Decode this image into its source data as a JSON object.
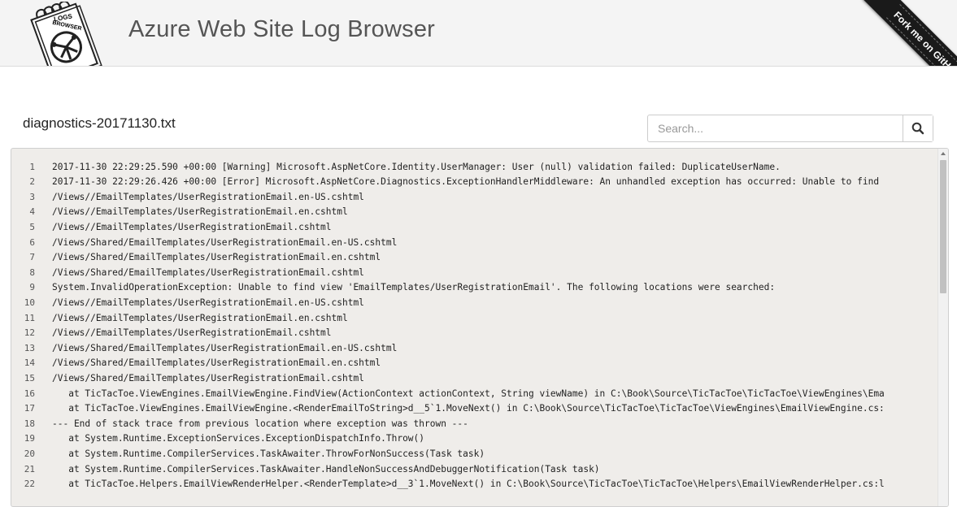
{
  "header": {
    "title": "Azure Web Site Log Browser",
    "logo_text_top": "LOGS",
    "logo_text_bottom": "BROWSER",
    "ribbon_label": "Fork me on GitHub"
  },
  "file": {
    "name": "diagnostics-20171130.txt"
  },
  "search": {
    "placeholder": "Search...",
    "icon": "search-icon"
  },
  "log": {
    "lines": [
      {
        "n": "1",
        "text": "2017-11-30 22:29:25.590 +00:00 [Warning] Microsoft.AspNetCore.Identity.UserManager: User (null) validation failed: DuplicateUserName."
      },
      {
        "n": "2",
        "text": "2017-11-30 22:29:26.426 +00:00 [Error] Microsoft.AspNetCore.Diagnostics.ExceptionHandlerMiddleware: An unhandled exception has occurred: Unable to find"
      },
      {
        "n": "3",
        "text": "/Views//EmailTemplates/UserRegistrationEmail.en-US.cshtml"
      },
      {
        "n": "4",
        "text": "/Views//EmailTemplates/UserRegistrationEmail.en.cshtml"
      },
      {
        "n": "5",
        "text": "/Views//EmailTemplates/UserRegistrationEmail.cshtml"
      },
      {
        "n": "6",
        "text": "/Views/Shared/EmailTemplates/UserRegistrationEmail.en-US.cshtml"
      },
      {
        "n": "7",
        "text": "/Views/Shared/EmailTemplates/UserRegistrationEmail.en.cshtml"
      },
      {
        "n": "8",
        "text": "/Views/Shared/EmailTemplates/UserRegistrationEmail.cshtml"
      },
      {
        "n": "9",
        "text": "System.InvalidOperationException: Unable to find view 'EmailTemplates/UserRegistrationEmail'. The following locations were searched:"
      },
      {
        "n": "10",
        "text": "/Views//EmailTemplates/UserRegistrationEmail.en-US.cshtml"
      },
      {
        "n": "11",
        "text": "/Views//EmailTemplates/UserRegistrationEmail.en.cshtml"
      },
      {
        "n": "12",
        "text": "/Views//EmailTemplates/UserRegistrationEmail.cshtml"
      },
      {
        "n": "13",
        "text": "/Views/Shared/EmailTemplates/UserRegistrationEmail.en-US.cshtml"
      },
      {
        "n": "14",
        "text": "/Views/Shared/EmailTemplates/UserRegistrationEmail.en.cshtml"
      },
      {
        "n": "15",
        "text": "/Views/Shared/EmailTemplates/UserRegistrationEmail.cshtml"
      },
      {
        "n": "16",
        "text": "   at TicTacToe.ViewEngines.EmailViewEngine.FindView(ActionContext actionContext, String viewName) in C:\\Book\\Source\\TicTacToe\\TicTacToe\\ViewEngines\\Ema"
      },
      {
        "n": "17",
        "text": "   at TicTacToe.ViewEngines.EmailViewEngine.<RenderEmailToString>d__5`1.MoveNext() in C:\\Book\\Source\\TicTacToe\\TicTacToe\\ViewEngines\\EmailViewEngine.cs:"
      },
      {
        "n": "18",
        "text": "--- End of stack trace from previous location where exception was thrown ---"
      },
      {
        "n": "19",
        "text": "   at System.Runtime.ExceptionServices.ExceptionDispatchInfo.Throw()"
      },
      {
        "n": "20",
        "text": "   at System.Runtime.CompilerServices.TaskAwaiter.ThrowForNonSuccess(Task task)"
      },
      {
        "n": "21",
        "text": "   at System.Runtime.CompilerServices.TaskAwaiter.HandleNonSuccessAndDebuggerNotification(Task task)"
      },
      {
        "n": "22",
        "text": "   at TicTacToe.Helpers.EmailViewRenderHelper.<RenderTemplate>d__3`1.MoveNext() in C:\\Book\\Source\\TicTacToe\\TicTacToe\\Helpers\\EmailViewRenderHelper.cs:l"
      }
    ]
  },
  "colors": {
    "header_bg": "#f4f4f4",
    "title": "#555555",
    "log_bg": "#efedea",
    "ribbon": "#1a1a1a"
  }
}
